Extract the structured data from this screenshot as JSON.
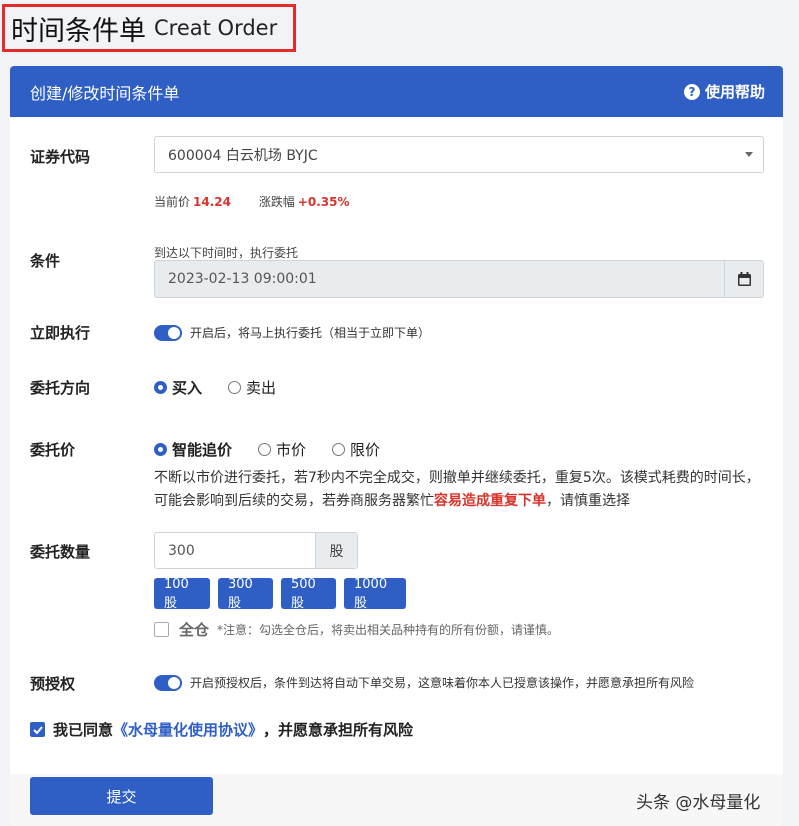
{
  "page_title": {
    "zh": "时间条件单",
    "en": "Creat Order"
  },
  "card": {
    "header_title": "创建/修改时间条件单",
    "help_label": "使用帮助"
  },
  "security": {
    "label": "证券代码",
    "selected": "600004 白云机场 BYJC",
    "price_label": "当前价",
    "price": "14.24",
    "change_label": "涨跌幅",
    "change": "+0.35%"
  },
  "condition": {
    "label": "条件",
    "hint": "到达以下时间时，执行委托",
    "datetime": "2023-02-13 09:00:01"
  },
  "immediate": {
    "label": "立即执行",
    "enabled": true,
    "text": "开启后，将马上执行委托（相当于立即下单）"
  },
  "direction": {
    "label": "委托方向",
    "options": [
      "买入",
      "卖出"
    ],
    "selected": "买入"
  },
  "price_type": {
    "label": "委托价",
    "options": [
      "智能追价",
      "市价",
      "限价"
    ],
    "selected": "智能追价",
    "desc_1": "不断以市价进行委托，若7秒内不完全成交，则撤单并继续委托，重复5次。该模式耗费的时间长，可能会影响到后续的交易，若券商服务器繁忙",
    "desc_warn": "容易造成重复下单",
    "desc_2": "，请慎重选择"
  },
  "quantity": {
    "label": "委托数量",
    "value": "300",
    "unit": "股",
    "quick": [
      "100股",
      "300股",
      "500股",
      "1000股"
    ],
    "all_label": "全仓",
    "all_note": "*注意：勾选全仓后，将卖出相关品种持有的所有份额，请谨慎。"
  },
  "preauth": {
    "label": "预授权",
    "enabled": true,
    "text": "开启预授权后，条件到达将自动下单交易，这意味着你本人已授意该操作，并愿意承担所有风险"
  },
  "agreement": {
    "checked": true,
    "prefix": "我已同意",
    "link": "《水母量化使用协议》",
    "suffix": "，并愿意承担所有风险"
  },
  "submit_label": "提交",
  "watermark": "头条 @水母量化",
  "colors": {
    "primary": "#2f5fc4",
    "danger": "#d9342b",
    "highlight_border": "#e32b2b"
  },
  "icons": {
    "help": "question-circle-icon",
    "calendar": "calendar-icon",
    "select": "caret-down-icon",
    "check": "check-icon"
  }
}
